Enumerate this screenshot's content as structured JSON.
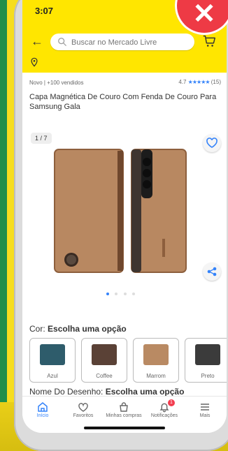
{
  "status": {
    "time": "3:07"
  },
  "search": {
    "placeholder": "Buscar no Mercado Livre"
  },
  "product": {
    "meta": "Novo | +100 vendidos",
    "rating": {
      "value": "4.7",
      "count": "(15)",
      "stars": "★★★★★"
    },
    "title": "Capa Magnética De Couro Com Fenda De Couro Para Samsung Gala",
    "image_counter": "1 / 7",
    "carousel": {
      "active_index": 1,
      "total_dots": 4
    }
  },
  "color_section": {
    "label": "Cor: ",
    "value": "Escolha uma opção",
    "options": [
      {
        "name": "Azul",
        "color": "#2e5c6b"
      },
      {
        "name": "Coffee",
        "color": "#5a4136"
      },
      {
        "name": "Marrom",
        "color": "#b98a63"
      },
      {
        "name": "Preto",
        "color": "#3b3b3b"
      }
    ]
  },
  "design_section": {
    "label": "Nome Do Desenho: ",
    "value": "Escolha uma opção"
  },
  "bottom_nav": {
    "items": [
      {
        "label": "Início"
      },
      {
        "label": "Favoritos"
      },
      {
        "label": "Minhas compras"
      },
      {
        "label": "Notificações",
        "badge": "1"
      },
      {
        "label": "Mais"
      }
    ]
  },
  "colors": {
    "yellow": "#ffe600",
    "accent": "#3483fa",
    "badge": "#f23d4f"
  }
}
